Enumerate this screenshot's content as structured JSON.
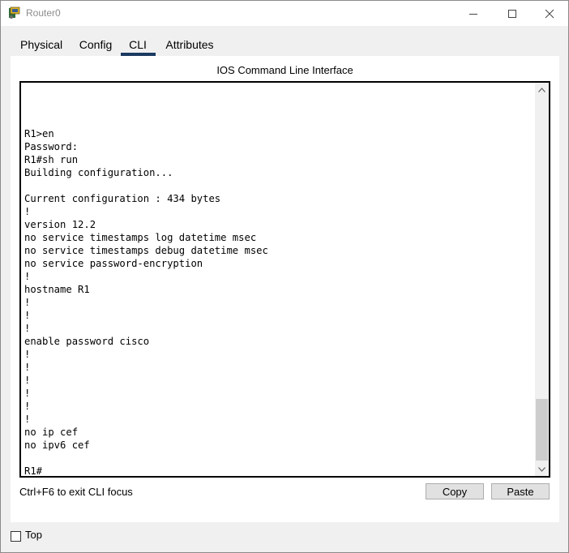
{
  "window": {
    "title": "Router0",
    "icon": "router-app-icon"
  },
  "tabs": [
    {
      "label": "Physical",
      "active": false
    },
    {
      "label": "Config",
      "active": false
    },
    {
      "label": "CLI",
      "active": true
    },
    {
      "label": "Attributes",
      "active": false
    }
  ],
  "cli": {
    "panel_title": "IOS Command Line Interface",
    "terminal_text": "\n\n\nR1>en\nPassword:\nR1#sh run\nBuilding configuration...\n\nCurrent configuration : 434 bytes\n!\nversion 12.2\nno service timestamps log datetime msec\nno service timestamps debug datetime msec\nno service password-encryption\n!\nhostname R1\n!\n!\n!\nenable password cisco\n!\n!\n!\n!\n!\n!\nno ip cef\nno ipv6 cef\n\nR1#",
    "hint": "Ctrl+F6 to exit CLI focus",
    "copy_label": "Copy",
    "paste_label": "Paste"
  },
  "footer": {
    "top_label": "Top",
    "top_checked": false
  },
  "colors": {
    "active_tab_underline": "#1c3a61",
    "window_background": "#f0f0f0"
  }
}
